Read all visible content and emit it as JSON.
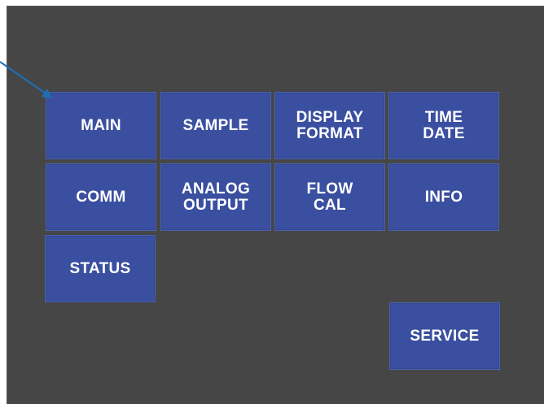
{
  "menu": {
    "main": "MAIN",
    "sample": "SAMPLE",
    "display_format": "DISPLAY\nFORMAT",
    "time_date": "TIME\nDATE",
    "comm": "COMM",
    "analog_output": "ANALOG\nOUTPUT",
    "flow_cal": "FLOW\nCAL",
    "info": "INFO",
    "status": "STATUS",
    "service": "SERVICE"
  },
  "colors": {
    "screen_background": "#464646",
    "button_fill": "#3a4f9f",
    "button_text": "#ffffff",
    "callout_arrow": "#1f6fb5"
  },
  "icons": {
    "callout": "arrow-pointer-icon"
  }
}
